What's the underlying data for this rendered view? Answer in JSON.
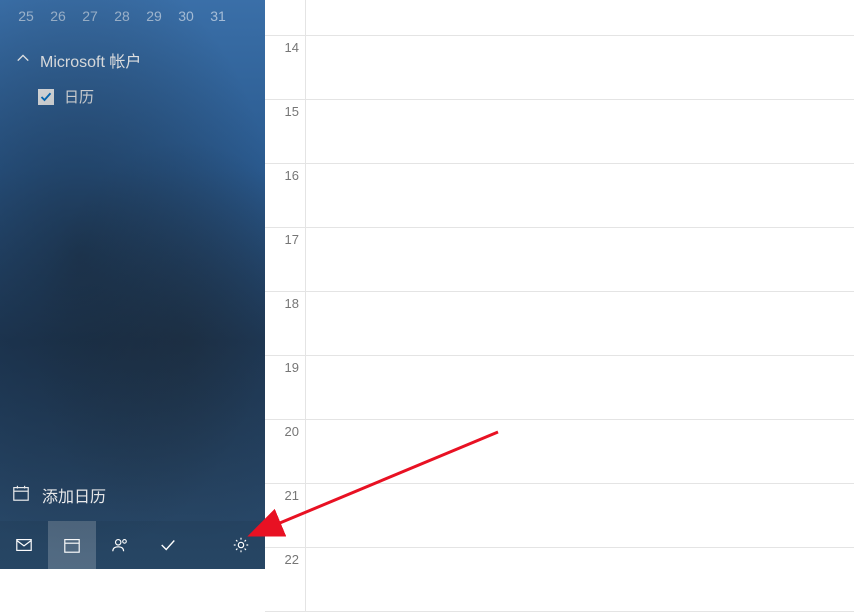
{
  "mini_calendar": {
    "days": [
      "25",
      "26",
      "27",
      "28",
      "29",
      "30",
      "31"
    ]
  },
  "account": {
    "title": "Microsoft 帐户",
    "calendars": [
      {
        "label": "日历",
        "checked": true
      }
    ]
  },
  "add_calendar": {
    "label": "添加日历"
  },
  "hours": [
    "",
    "14",
    "15",
    "16",
    "17",
    "18",
    "19",
    "20",
    "21",
    "22"
  ],
  "colors": {
    "accent": "#0078d4"
  }
}
